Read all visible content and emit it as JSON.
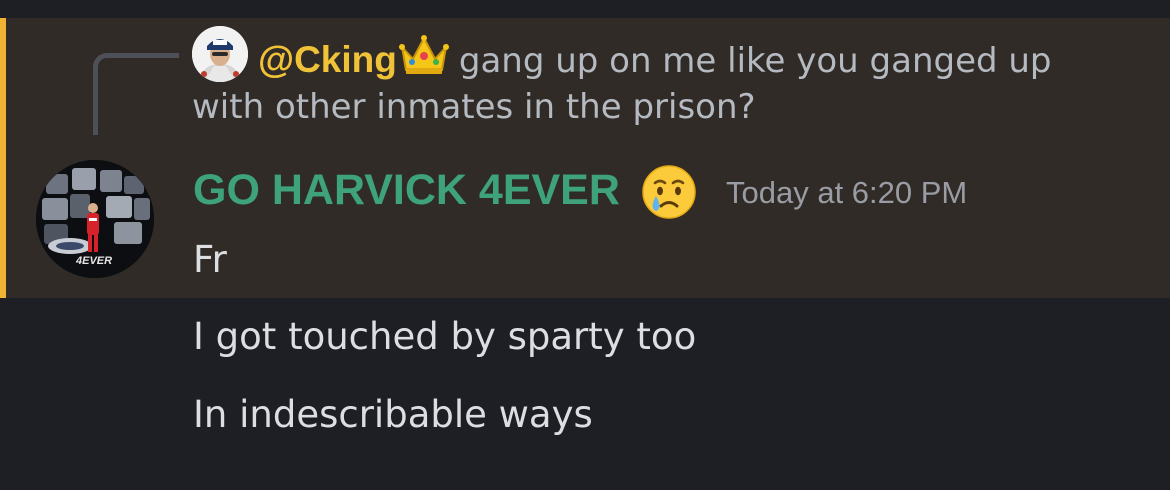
{
  "reply": {
    "username": "@Cking",
    "badge_emoji": "crown-emoji",
    "preview_line1": "gang up on me like you ganged up",
    "preview_line2": "with other inmates in the prison?"
  },
  "message": {
    "author": "GO HARVICK 4EVER",
    "author_emoji": "crying-face-emoji",
    "timestamp": "Today at 6:20 PM",
    "avatar_text": "4EVER",
    "lines": [
      "Fr",
      "I got touched by sparty too",
      "In indescribable ways"
    ]
  },
  "colors": {
    "background": "#1e1f24",
    "highlight_background": "#302b27",
    "highlight_bar": "#f0b232",
    "reply_username": "#f0c238",
    "author_name": "#3ea27a",
    "message_text": "#dcdee1",
    "muted_text": "#b5bac1",
    "timestamp": "#9a9ca3"
  }
}
